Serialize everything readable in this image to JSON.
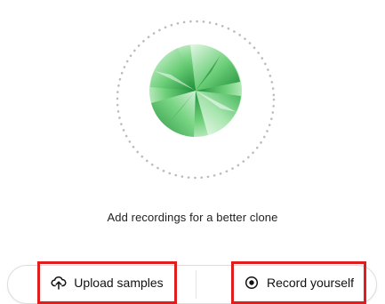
{
  "voice_clone": {
    "hint_text": "Add recordings for a better clone",
    "visual_icon": "voice-orb-graphic",
    "accent_color": "#3fbf54",
    "highlight_color": "#e01e1e",
    "actions": {
      "upload": {
        "label": "Upload samples",
        "icon": "cloud-upload-icon"
      },
      "record": {
        "label": "Record yourself",
        "icon": "record-dot-icon"
      }
    }
  }
}
